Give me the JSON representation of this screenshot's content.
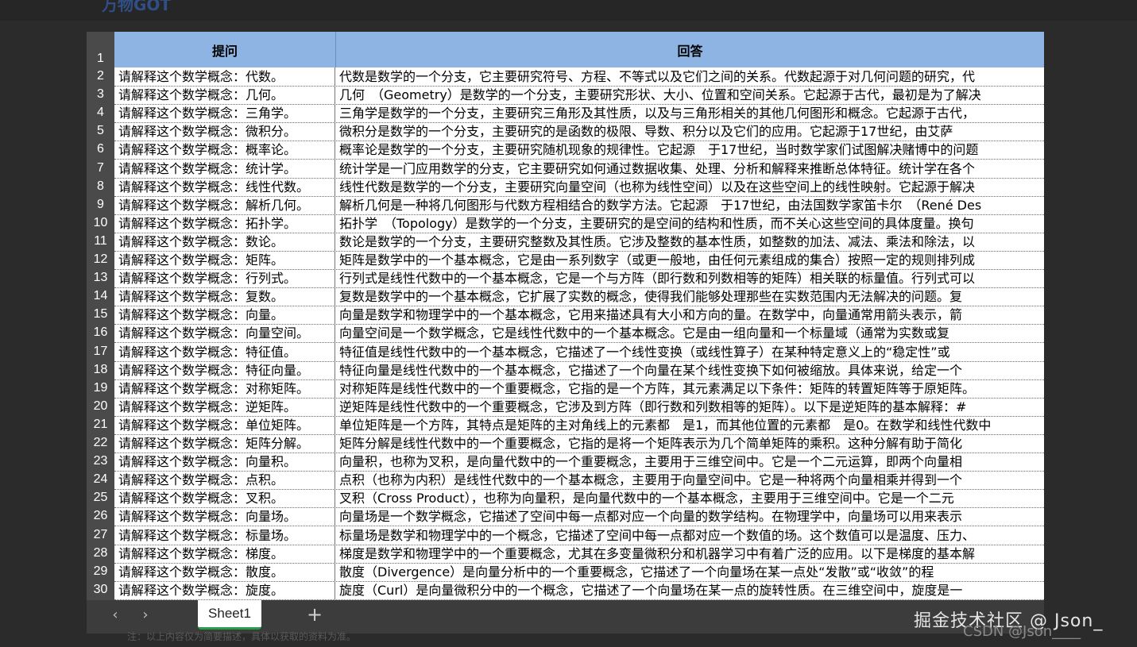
{
  "top_text": "万物GOT",
  "columns": {
    "q_header": "提问",
    "a_header": "回答",
    "header_row_number": "1"
  },
  "rows": [
    {
      "n": "2",
      "q": "请解释这个数学概念：代数。",
      "a": "代数是数学的一个分支，它主要研究符号、方程、不等式以及它们之间的关系。代数起源于对几何问题的研究，代"
    },
    {
      "n": "3",
      "q": "请解释这个数学概念：几何。",
      "a": "几何　（Geometry）是数学的一个分支，主要研究形状、大小、位置和空间关系。它起源于古代，最初是为了解决"
    },
    {
      "n": "4",
      "q": "请解释这个数学概念：三角学。",
      "a": "三角学是数学的一个分支，主要研究三角形及其性质，以及与三角形相关的其他几何图形和概念。它起源于古代，"
    },
    {
      "n": "5",
      "q": "请解释这个数学概念：微积分。",
      "a": "微积分是数学的一个分支，主要研究的是函数的极限、导数、积分以及它们的应用。它起源于17世纪，由艾萨"
    },
    {
      "n": "6",
      "q": "请解释这个数学概念：概率论。",
      "a": "概率论是数学的一个分支，主要研究随机现象的规律性。它起源　于17世纪，当时数学家们试图解决赌博中的问题"
    },
    {
      "n": "7",
      "q": "请解释这个数学概念：统计学。",
      "a": "统计学是一门应用数学的分支，它主要研究如何通过数据收集、处理、分析和解释来推断总体特征。统计学在各个"
    },
    {
      "n": "8",
      "q": "请解释这个数学概念：线性代数。",
      "a": "线性代数是数学的一个分支，主要研究向量空间（也称为线性空间）以及在这些空间上的线性映射。它起源于解决"
    },
    {
      "n": "9",
      "q": "请解释这个数学概念：解析几何。",
      "a": "解析几何是一种将几何图形与代数方程相结合的数学方法。它起源　于17世纪，由法国数学家笛卡尔　（René Des"
    },
    {
      "n": "10",
      "q": "请解释这个数学概念：拓扑学。",
      "a": "拓扑学　（Topology）是数学的一个分支，主要研究的是空间的结构和性质，而不关心这些空间的具体度量。换句"
    },
    {
      "n": "11",
      "q": "请解释这个数学概念：数论。",
      "a": "数论是数学的一个分支，主要研究整数及其性质。它涉及整数的基本性质，如整数的加法、减法、乘法和除法，以"
    },
    {
      "n": "12",
      "q": "请解释这个数学概念：矩阵。",
      "a": "矩阵是数学中的一个基本概念，它是由一系列数字（或更一般地，由任何元素组成的集合）按照一定的规则排列成"
    },
    {
      "n": "13",
      "q": "请解释这个数学概念：行列式。",
      "a": "行列式是线性代数中的一个基本概念，它是一个与方阵（即行数和列数相等的矩阵）相关联的标量值。行列式可以"
    },
    {
      "n": "14",
      "q": "请解释这个数学概念：复数。",
      "a": "复数是数学中的一个基本概念，它扩展了实数的概念，使得我们能够处理那些在实数范围内无法解决的问题。复"
    },
    {
      "n": "15",
      "q": "请解释这个数学概念：向量。",
      "a": "向量是数学和物理学中的一个基本概念，它用来描述具有大小和方向的量。在数学中，向量通常用箭头表示，箭"
    },
    {
      "n": "16",
      "q": "请解释这个数学概念：向量空间。",
      "a": "向量空间是一个数学概念，它是线性代数中的一个基本概念。它是由一组向量和一个标量域（通常为实数或复"
    },
    {
      "n": "17",
      "q": "请解释这个数学概念：特征值。",
      "a": "特征值是线性代数中的一个基本概念，它描述了一个线性变换（或线性算子）在某种特定意义上的“稳定性”或"
    },
    {
      "n": "18",
      "q": "请解释这个数学概念：特征向量。",
      "a": "特征向量是线性代数中的一个基本概念，它描述了一个向量在某个线性变换下如何被缩放。具体来说，给定一个"
    },
    {
      "n": "19",
      "q": "请解释这个数学概念：对称矩阵。",
      "a": "对称矩阵是线性代数中的一个重要概念，它指的是一个方阵，其元素满足以下条件：矩阵的转置矩阵等于原矩阵。"
    },
    {
      "n": "20",
      "q": "请解释这个数学概念：逆矩阵。",
      "a": "逆矩阵是线性代数中的一个重要概念，它涉及到方阵（即行数和列数相等的矩阵）。以下是逆矩阵的基本解释：#"
    },
    {
      "n": "21",
      "q": "请解释这个数学概念：单位矩阵。",
      "a": "单位矩阵是一个方阵，其特点是矩阵的主对角线上的元素都　是1，而其他位置的元素都　是0。在数学和线性代数中"
    },
    {
      "n": "22",
      "q": "请解释这个数学概念：矩阵分解。",
      "a": "矩阵分解是线性代数中的一个重要概念，它指的是将一个矩阵表示为几个简单矩阵的乘积。这种分解有助于简化"
    },
    {
      "n": "23",
      "q": "请解释这个数学概念：向量积。",
      "a": "向量积，也称为叉积，是向量代数中的一个重要概念，主要用于三维空间中。它是一个二元运算，即两个向量相"
    },
    {
      "n": "24",
      "q": "请解释这个数学概念：点积。",
      "a": "点积（也称为内积）是线性代数中的一个基本概念，主要用于向量空间中。它是一种将两个向量相乘并得到一个"
    },
    {
      "n": "25",
      "q": "请解释这个数学概念：叉积。",
      "a": "叉积（Cross Product），也称为向量积，是向量代数中的一个基本概念，主要用于三维空间中。它是一个二元"
    },
    {
      "n": "26",
      "q": "请解释这个数学概念：向量场。",
      "a": "向量场是一个数学概念，它描述了空间中每一点都对应一个向量的数学结构。在物理学中，向量场可以用来表示"
    },
    {
      "n": "27",
      "q": "请解释这个数学概念：标量场。",
      "a": "标量场是数学和物理学中的一个概念，它描述了空间中每一点都对应一个数值的场。这个数值可以是温度、压力、"
    },
    {
      "n": "28",
      "q": "请解释这个数学概念：梯度。",
      "a": "梯度是数学和物理学中的一个重要概念，尤其在多变量微积分和机器学习中有着广泛的应用。以下是梯度的基本解"
    },
    {
      "n": "29",
      "q": "请解释这个数学概念：散度。",
      "a": "散度（Divergence）是向量分析中的一个重要概念，它描述了一个向量场在某一点处“发散”或“收敛”的程"
    },
    {
      "n": "30",
      "q": "请解释这个数学概念：旋度。",
      "a": "旋度（Curl）是向量微积分中的一个概念，它描述了一个向量场在某一点的旋转性质。在三维空间中，旋度是一"
    }
  ],
  "tabbar": {
    "nav_prev": "‹",
    "nav_next": "›",
    "active_tab": "Sheet1",
    "add": "+"
  },
  "note": "注：以上内容仅为简要描述，具体以获取的资料为准。",
  "watermark_line1": "掘金技术社区 @ Json_",
  "watermark_line2": "CSDN @Json____"
}
